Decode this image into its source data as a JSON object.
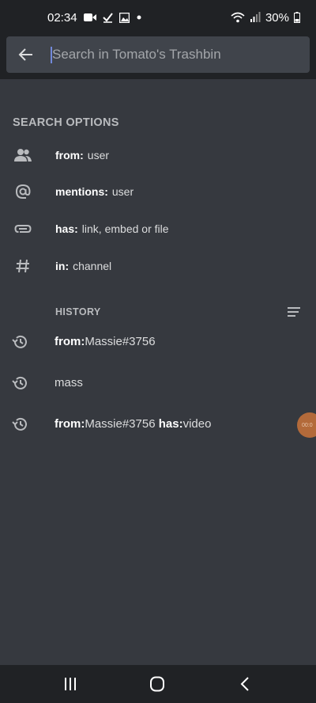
{
  "status_bar": {
    "time": "02:34",
    "battery": "30%",
    "icons": [
      "video-icon",
      "check-icon",
      "image-icon",
      "dot-icon",
      "wifi-icon",
      "signal-icon",
      "battery-icon"
    ]
  },
  "search": {
    "placeholder": "Search in Tomato's Trashbin",
    "value": ""
  },
  "search_options": {
    "title": "SEARCH OPTIONS",
    "items": [
      {
        "key": "from:",
        "hint": "user",
        "icon": "users-icon"
      },
      {
        "key": "mentions:",
        "hint": "user",
        "icon": "at-icon"
      },
      {
        "key": "has:",
        "hint": "link, embed or file",
        "icon": "paperclip-icon"
      },
      {
        "key": "in:",
        "hint": "channel",
        "icon": "hashtag-icon"
      }
    ]
  },
  "history": {
    "title": "HISTORY",
    "items": [
      {
        "parts": [
          {
            "text": "from:",
            "bold": true
          },
          {
            "text": "Massie#3756",
            "bold": false
          }
        ]
      },
      {
        "parts": [
          {
            "text": "mass",
            "bold": false
          }
        ]
      },
      {
        "parts": [
          {
            "text": "from:",
            "bold": true
          },
          {
            "text": "Massie#3756 ",
            "bold": false
          },
          {
            "text": "has:",
            "bold": true
          },
          {
            "text": "video",
            "bold": false
          }
        ]
      }
    ]
  },
  "floating_bubble": {
    "text": "00:0"
  },
  "colors": {
    "background": "#36393f",
    "bars": "#202225",
    "input": "#40444b",
    "accent": "#7289da",
    "bubble": "#b36a3a"
  }
}
